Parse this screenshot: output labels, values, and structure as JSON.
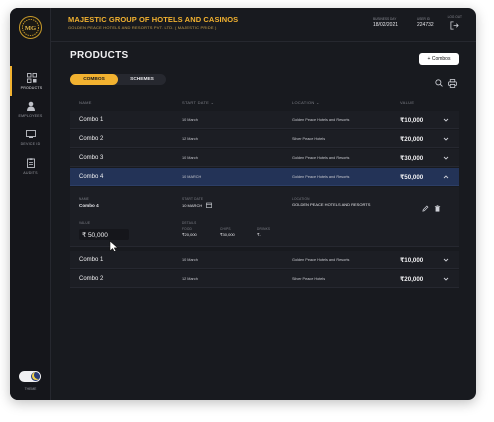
{
  "header": {
    "title": "MAJESTIC GROUP OF HOTELS AND CASINOS",
    "subtitle": "GOLDEN PEACE HOTELS AND RESORTS PVT. LTD. ( MAJESTIC PRIDE )",
    "business_day_label": "BUSINESS DAY",
    "business_day": "18/02/2021",
    "user_id_label": "USER ID",
    "user_id": "224732",
    "logout_label": "LOG OUT"
  },
  "sidebar": {
    "items": [
      {
        "label": "PRODUCTS",
        "icon": "products-icon"
      },
      {
        "label": "EMPLOYEES",
        "icon": "employees-icon"
      },
      {
        "label": "DEVICE ID",
        "icon": "device-icon"
      },
      {
        "label": "AUDITS",
        "icon": "audits-icon"
      }
    ],
    "theme_label": "THEME"
  },
  "page": {
    "title": "PRODUCTS",
    "add_button": "+ Combos",
    "tabs": [
      "COMBOS",
      "SCHEMES"
    ],
    "active_tab": "COMBOS"
  },
  "table": {
    "columns": [
      "NAME",
      "START DATE",
      "LOCATION",
      "VALUE"
    ],
    "rows": [
      {
        "name": "Combo 1",
        "date": "10 March",
        "location": "Golden Peace Hotels and Resorts",
        "value": "₹10,000"
      },
      {
        "name": "Combo 2",
        "date": "12 March",
        "location": "Silver Peace Hotels",
        "value": "₹20,000"
      },
      {
        "name": "Combo 3",
        "date": "10 March",
        "location": "Golden Peace Hotels and Resorts",
        "value": "₹30,000"
      },
      {
        "name": "Combo 4",
        "date": "10 MARCH",
        "location": "Golden Peace Hotels and Resorts",
        "value": "₹50,000"
      }
    ],
    "rows_after": [
      {
        "name": "Combo 1",
        "date": "10 March",
        "location": "Golden Peace Hotels and Resorts",
        "value": "₹10,000"
      },
      {
        "name": "Combo 2",
        "date": "12 March",
        "location": "Silver Peace Hotels",
        "value": "₹20,000"
      }
    ]
  },
  "detail": {
    "name_label": "NAME",
    "name": "Combo 4",
    "start_date_label": "START DATE",
    "start_date": "10 MARCH",
    "location_label": "LOCATION",
    "location": "GOLDEN PEACE HOTELS AND RESORTS",
    "value_label": "VALUE",
    "value": "₹  50,000",
    "details_label": "DETAILS",
    "food_label": "FOOD",
    "food": "₹20,000",
    "chips_label": "CHIPS",
    "chips": "₹30,000",
    "drinks_label": "DRINKS",
    "drinks": "₹-"
  },
  "colors": {
    "accent": "#f2b230",
    "selected_row": "#233357",
    "background": "#181a1f"
  }
}
